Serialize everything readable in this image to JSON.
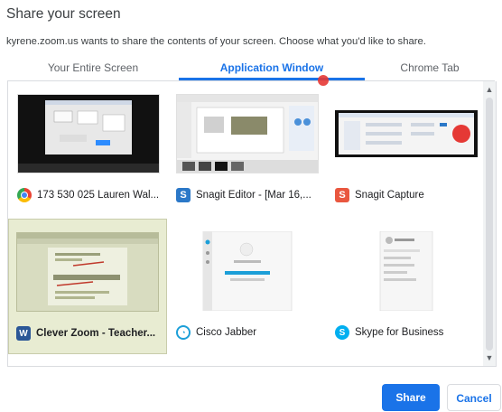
{
  "dialog": {
    "title": "Share your screen",
    "subtitle": "kyrene.zoom.us wants to share the contents of your screen. Choose what you'd like to share."
  },
  "tabs": [
    {
      "label": "Your Entire Screen",
      "active": false
    },
    {
      "label": "Application Window",
      "active": true
    },
    {
      "label": "Chrome Tab",
      "active": false
    }
  ],
  "windows": [
    {
      "label": "173 530 025 Lauren Wal...",
      "icon": "chrome-icon",
      "selected": false
    },
    {
      "label": "Snagit Editor - [Mar 16,...",
      "icon": "snagit-editor-icon",
      "selected": false
    },
    {
      "label": "Snagit Capture",
      "icon": "snagit-capture-icon",
      "selected": false
    },
    {
      "label": "Clever Zoom - Teacher...",
      "icon": "word-icon",
      "selected": true
    },
    {
      "label": "Cisco Jabber",
      "icon": "cisco-jabber-icon",
      "selected": false
    },
    {
      "label": "Skype for Business",
      "icon": "skype-icon",
      "selected": false
    }
  ],
  "buttons": {
    "share": "Share",
    "cancel": "Cancel"
  },
  "colors": {
    "accent": "#1a73e8",
    "selected_bg": "#e8ecd2"
  }
}
